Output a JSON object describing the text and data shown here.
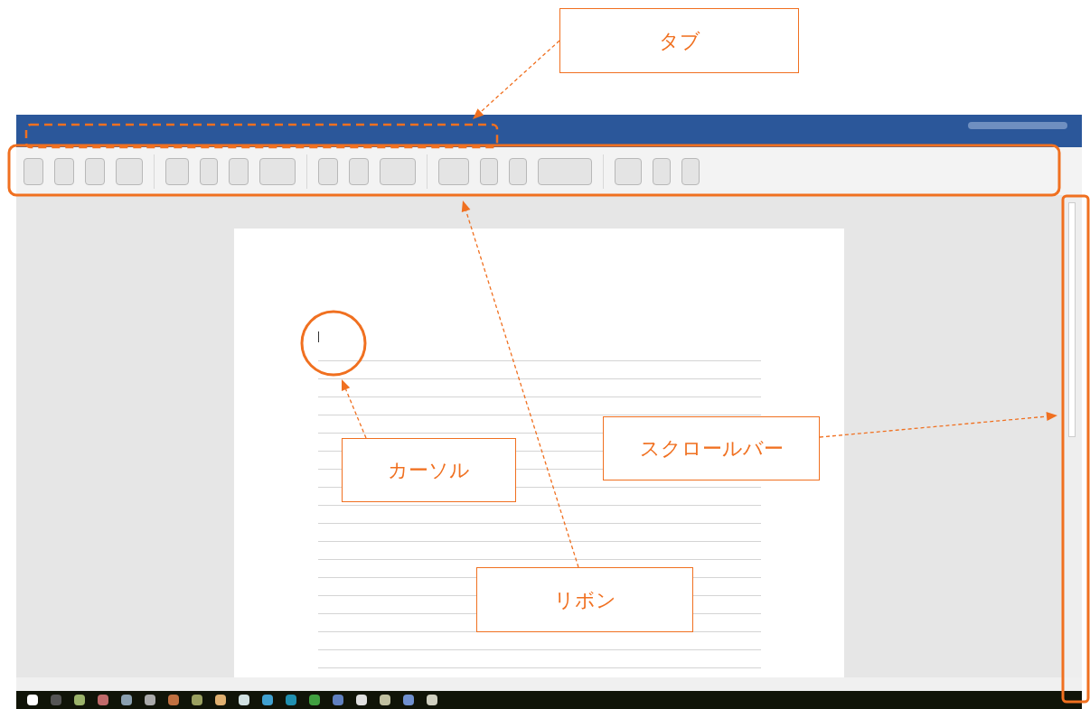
{
  "callouts": [
    {
      "label": "タブ"
    },
    {
      "label": "リボン"
    },
    {
      "label": "カーソル"
    },
    {
      "label": "スクロールバー"
    }
  ]
}
